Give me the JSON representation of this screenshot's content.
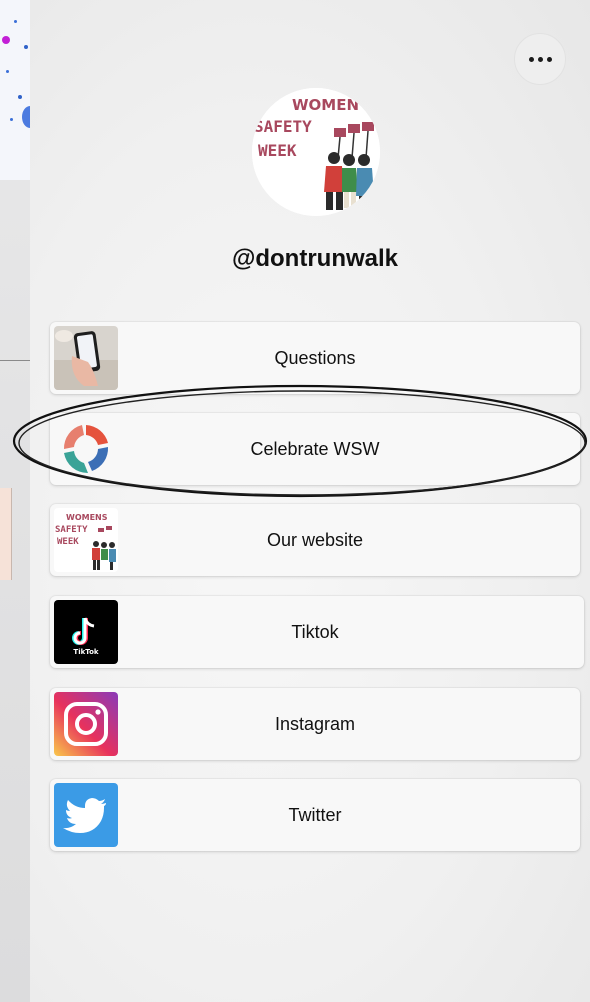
{
  "profile": {
    "handle": "@dontrunwalk",
    "avatar_text": [
      "WOMEN'S",
      "SAFETY",
      "WEEK"
    ]
  },
  "menu": {
    "more_icon": "more-horizontal-icon"
  },
  "links": [
    {
      "label": "Questions",
      "thumb": "phone-in-hand-photo"
    },
    {
      "label": "Celebrate WSW",
      "thumb": "community-logo-icon"
    },
    {
      "label": "Our website",
      "thumb": "womens-safety-week-logo",
      "thumb_text": [
        "WOMENS",
        "SAFETY",
        "WEEK"
      ]
    },
    {
      "label": "Tiktok",
      "thumb": "tiktok-icon",
      "thumb_text": "TikTok"
    },
    {
      "label": "Instagram",
      "thumb": "instagram-icon"
    },
    {
      "label": "Twitter",
      "thumb": "twitter-icon"
    }
  ],
  "colors": {
    "brand_maroon": "#a8485e",
    "tiktok_bg": "#000000",
    "twitter_blue": "#3b9be6",
    "instagram_gradient": [
      "#f9c84a",
      "#e8325c",
      "#8a3ab9"
    ]
  }
}
